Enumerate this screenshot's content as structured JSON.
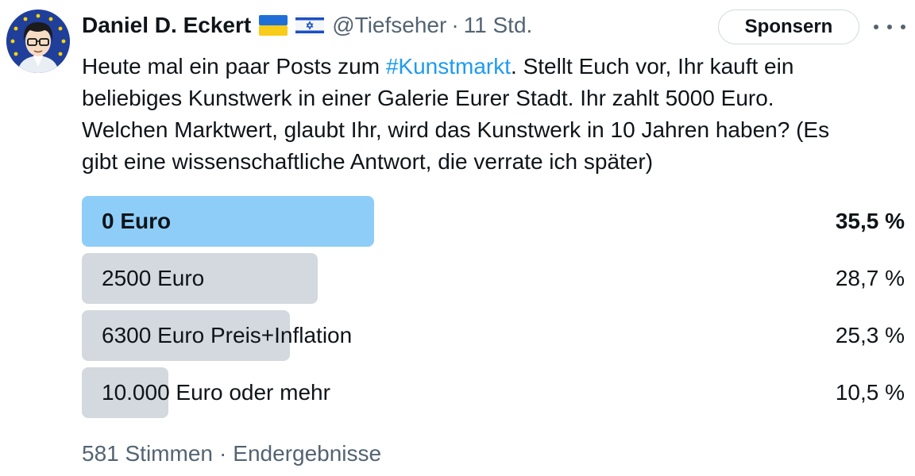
{
  "author": {
    "name": "Daniel D. Eckert",
    "handle": "@Tiefseher",
    "separator": "·",
    "time": "11 Std.",
    "flags": [
      "ukraine-flag",
      "israel-flag"
    ]
  },
  "actions": {
    "sponsor_label": "Sponsern",
    "more_icon": "more-horizontal-icon"
  },
  "tweet": {
    "lines": [
      {
        "before": "Heute mal ein paar Posts zum ",
        "hashtag": "#Kunstmarkt",
        "after": ". Stellt Euch vor, Ihr kauft ein"
      },
      {
        "text": "beliebiges Kunstwerk in einer Galerie Eurer Stadt. Ihr zahlt 5000 Euro."
      },
      {
        "text": "Welchen Marktwert, glaubt Ihr, wird das Kunstwerk in 10 Jahren haben? (Es"
      },
      {
        "text": "gibt eine wissenschaftliche Antwort, die verrate ich später)"
      }
    ]
  },
  "poll": {
    "options": [
      {
        "label": "0 Euro",
        "percent": "35,5 %",
        "share": 0.355,
        "winner": true
      },
      {
        "label": "2500 Euro",
        "percent": "28,7 %",
        "share": 0.287,
        "winner": false
      },
      {
        "label": "6300 Euro Preis+Inflation",
        "percent": "25,3 %",
        "share": 0.253,
        "winner": false
      },
      {
        "label": "10.000 Euro oder mehr",
        "percent": "10,5 %",
        "share": 0.105,
        "winner": false
      }
    ],
    "footer": {
      "votes": "581 Stimmen",
      "separator": "·",
      "status": "Endergebnisse"
    }
  },
  "colors": {
    "text": "#0f1419",
    "secondary": "#536471",
    "link": "#1d9bf0",
    "winner_bar": "#8ecdf8",
    "bar": "#d3d9de"
  }
}
